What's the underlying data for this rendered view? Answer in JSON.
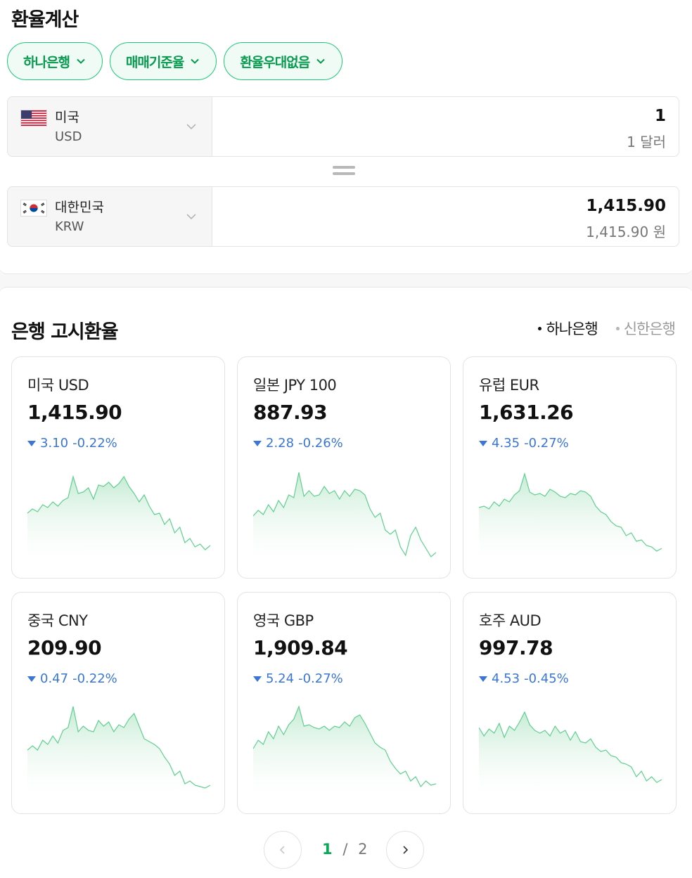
{
  "converter": {
    "title": "환율계산",
    "filters": [
      {
        "label": "하나은행"
      },
      {
        "label": "매매기준율"
      },
      {
        "label": "환율우대없음"
      }
    ],
    "from": {
      "country": "미국",
      "code": "USD",
      "amount": "1",
      "amount_text": "1 달러"
    },
    "to": {
      "country": "대한민국",
      "code": "KRW",
      "amount": "1,415.90",
      "amount_text": "1,415.90 원"
    }
  },
  "rates": {
    "title": "은행 고시환율",
    "bank_tabs": [
      {
        "label": "하나은행",
        "active": true
      },
      {
        "label": "신한은행",
        "active": false
      }
    ],
    "cards": [
      {
        "name": "미국 USD",
        "rate": "1,415.90",
        "change": "3.10",
        "pct": "-0.22%"
      },
      {
        "name": "일본 JPY 100",
        "rate": "887.93",
        "change": "2.28",
        "pct": "-0.26%"
      },
      {
        "name": "유럽 EUR",
        "rate": "1,631.26",
        "change": "4.35",
        "pct": "-0.27%"
      },
      {
        "name": "중국 CNY",
        "rate": "209.90",
        "change": "0.47",
        "pct": "-0.22%"
      },
      {
        "name": "영국 GBP",
        "rate": "1,909.84",
        "change": "5.24",
        "pct": "-0.27%"
      },
      {
        "name": "호주 AUD",
        "rate": "997.78",
        "change": "4.53",
        "pct": "-0.45%"
      }
    ]
  },
  "pagination": {
    "current": "1",
    "separator": "/",
    "total": "2"
  },
  "colors": {
    "accent": "#07a957",
    "down": "#3b76d6",
    "sparkline": "#5fcf8f"
  },
  "icons": {
    "filter_dropdown": "chevron-down-icon",
    "currency_select": "chevron-down-icon",
    "prev": "chevron-left-icon",
    "next": "chevron-right-icon"
  }
}
